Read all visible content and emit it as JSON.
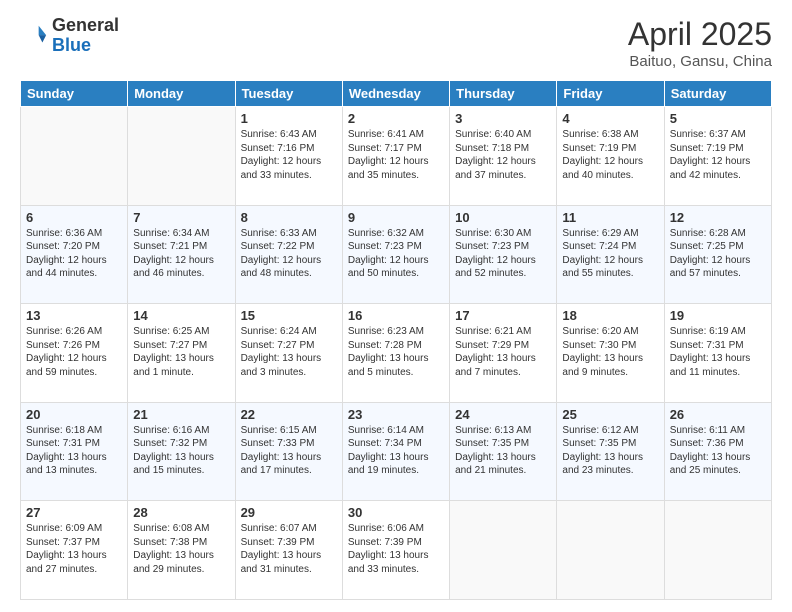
{
  "header": {
    "logo_general": "General",
    "logo_blue": "Blue",
    "main_title": "April 2025",
    "subtitle": "Baituo, Gansu, China"
  },
  "columns": [
    "Sunday",
    "Monday",
    "Tuesday",
    "Wednesday",
    "Thursday",
    "Friday",
    "Saturday"
  ],
  "rows": [
    [
      {
        "day": "",
        "info": ""
      },
      {
        "day": "",
        "info": ""
      },
      {
        "day": "1",
        "info": "Sunrise: 6:43 AM\nSunset: 7:16 PM\nDaylight: 12 hours and 33 minutes."
      },
      {
        "day": "2",
        "info": "Sunrise: 6:41 AM\nSunset: 7:17 PM\nDaylight: 12 hours and 35 minutes."
      },
      {
        "day": "3",
        "info": "Sunrise: 6:40 AM\nSunset: 7:18 PM\nDaylight: 12 hours and 37 minutes."
      },
      {
        "day": "4",
        "info": "Sunrise: 6:38 AM\nSunset: 7:19 PM\nDaylight: 12 hours and 40 minutes."
      },
      {
        "day": "5",
        "info": "Sunrise: 6:37 AM\nSunset: 7:19 PM\nDaylight: 12 hours and 42 minutes."
      }
    ],
    [
      {
        "day": "6",
        "info": "Sunrise: 6:36 AM\nSunset: 7:20 PM\nDaylight: 12 hours and 44 minutes."
      },
      {
        "day": "7",
        "info": "Sunrise: 6:34 AM\nSunset: 7:21 PM\nDaylight: 12 hours and 46 minutes."
      },
      {
        "day": "8",
        "info": "Sunrise: 6:33 AM\nSunset: 7:22 PM\nDaylight: 12 hours and 48 minutes."
      },
      {
        "day": "9",
        "info": "Sunrise: 6:32 AM\nSunset: 7:23 PM\nDaylight: 12 hours and 50 minutes."
      },
      {
        "day": "10",
        "info": "Sunrise: 6:30 AM\nSunset: 7:23 PM\nDaylight: 12 hours and 52 minutes."
      },
      {
        "day": "11",
        "info": "Sunrise: 6:29 AM\nSunset: 7:24 PM\nDaylight: 12 hours and 55 minutes."
      },
      {
        "day": "12",
        "info": "Sunrise: 6:28 AM\nSunset: 7:25 PM\nDaylight: 12 hours and 57 minutes."
      }
    ],
    [
      {
        "day": "13",
        "info": "Sunrise: 6:26 AM\nSunset: 7:26 PM\nDaylight: 12 hours and 59 minutes."
      },
      {
        "day": "14",
        "info": "Sunrise: 6:25 AM\nSunset: 7:27 PM\nDaylight: 13 hours and 1 minute."
      },
      {
        "day": "15",
        "info": "Sunrise: 6:24 AM\nSunset: 7:27 PM\nDaylight: 13 hours and 3 minutes."
      },
      {
        "day": "16",
        "info": "Sunrise: 6:23 AM\nSunset: 7:28 PM\nDaylight: 13 hours and 5 minutes."
      },
      {
        "day": "17",
        "info": "Sunrise: 6:21 AM\nSunset: 7:29 PM\nDaylight: 13 hours and 7 minutes."
      },
      {
        "day": "18",
        "info": "Sunrise: 6:20 AM\nSunset: 7:30 PM\nDaylight: 13 hours and 9 minutes."
      },
      {
        "day": "19",
        "info": "Sunrise: 6:19 AM\nSunset: 7:31 PM\nDaylight: 13 hours and 11 minutes."
      }
    ],
    [
      {
        "day": "20",
        "info": "Sunrise: 6:18 AM\nSunset: 7:31 PM\nDaylight: 13 hours and 13 minutes."
      },
      {
        "day": "21",
        "info": "Sunrise: 6:16 AM\nSunset: 7:32 PM\nDaylight: 13 hours and 15 minutes."
      },
      {
        "day": "22",
        "info": "Sunrise: 6:15 AM\nSunset: 7:33 PM\nDaylight: 13 hours and 17 minutes."
      },
      {
        "day": "23",
        "info": "Sunrise: 6:14 AM\nSunset: 7:34 PM\nDaylight: 13 hours and 19 minutes."
      },
      {
        "day": "24",
        "info": "Sunrise: 6:13 AM\nSunset: 7:35 PM\nDaylight: 13 hours and 21 minutes."
      },
      {
        "day": "25",
        "info": "Sunrise: 6:12 AM\nSunset: 7:35 PM\nDaylight: 13 hours and 23 minutes."
      },
      {
        "day": "26",
        "info": "Sunrise: 6:11 AM\nSunset: 7:36 PM\nDaylight: 13 hours and 25 minutes."
      }
    ],
    [
      {
        "day": "27",
        "info": "Sunrise: 6:09 AM\nSunset: 7:37 PM\nDaylight: 13 hours and 27 minutes."
      },
      {
        "day": "28",
        "info": "Sunrise: 6:08 AM\nSunset: 7:38 PM\nDaylight: 13 hours and 29 minutes."
      },
      {
        "day": "29",
        "info": "Sunrise: 6:07 AM\nSunset: 7:39 PM\nDaylight: 13 hours and 31 minutes."
      },
      {
        "day": "30",
        "info": "Sunrise: 6:06 AM\nSunset: 7:39 PM\nDaylight: 13 hours and 33 minutes."
      },
      {
        "day": "",
        "info": ""
      },
      {
        "day": "",
        "info": ""
      },
      {
        "day": "",
        "info": ""
      }
    ]
  ]
}
